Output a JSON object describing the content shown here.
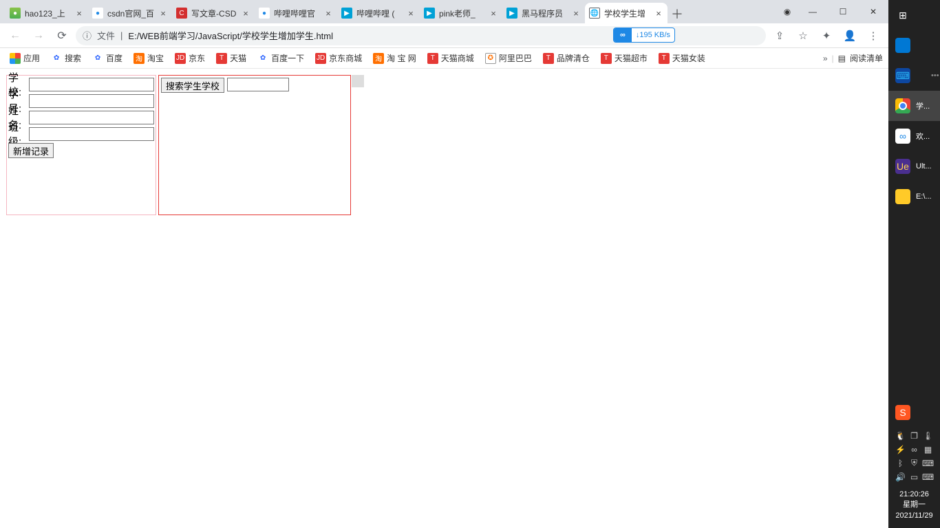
{
  "tabs": [
    {
      "title": "hao123_上",
      "favicon": "hao"
    },
    {
      "title": "csdn官网_百",
      "favicon": "csdn"
    },
    {
      "title": "写文章-CSD",
      "favicon": "c"
    },
    {
      "title": "哔哩哔哩官",
      "favicon": "csdn"
    },
    {
      "title": "哔哩哔哩 (",
      "favicon": "bili"
    },
    {
      "title": "pink老师_",
      "favicon": "bili"
    },
    {
      "title": "黑马程序员",
      "favicon": "bili"
    },
    {
      "title": "学校学生增",
      "favicon": "globe",
      "active": true
    }
  ],
  "address": {
    "prefix": "文件",
    "url": "E:/WEB前端学习/JavaScript/学校学生增加学生.html"
  },
  "netbadge": {
    "speed": "195 KB/s"
  },
  "bookmarks": [
    {
      "label": "应用",
      "ico": "apps"
    },
    {
      "label": "搜索",
      "ico": "baidu"
    },
    {
      "label": "百度",
      "ico": "baidu"
    },
    {
      "label": "淘宝",
      "ico": "tb"
    },
    {
      "label": "京东",
      "ico": "jd"
    },
    {
      "label": "天猫",
      "ico": "t"
    },
    {
      "label": "百度一下",
      "ico": "baidu"
    },
    {
      "label": "京东商城",
      "ico": "jd"
    },
    {
      "label": "淘 宝 网",
      "ico": "tb"
    },
    {
      "label": "天猫商城",
      "ico": "t"
    },
    {
      "label": "阿里巴巴",
      "ico": "ali"
    },
    {
      "label": "品牌清仓",
      "ico": "t"
    },
    {
      "label": "天猫超市",
      "ico": "t"
    },
    {
      "label": "天猫女装",
      "ico": "t"
    }
  ],
  "bookmarks_right": {
    "reading_list": "阅读清单"
  },
  "form": {
    "school_label": "学校:",
    "id_label": "学号:",
    "name_label": "姓名:",
    "class_label": "班级:",
    "add_btn": "新增记录",
    "search_btn": "搜索学生学校"
  },
  "taskbar_items": [
    {
      "label": "",
      "ico": "win"
    },
    {
      "label": "",
      "ico": "msg"
    },
    {
      "label": "",
      "ico": "vscode",
      "dot": true
    },
    {
      "label": "学...",
      "ico": "chrome",
      "active": true
    },
    {
      "label": "欢...",
      "ico": "bdisk"
    },
    {
      "label": "Ult...",
      "ico": "ue"
    },
    {
      "label": "E:\\...",
      "ico": "folder"
    }
  ],
  "tray_icons": [
    "sogou",
    "qq",
    "win",
    "temp",
    "flash",
    "bdisk",
    "doc",
    "bt",
    "shield",
    "kb",
    "vol",
    "notif"
  ],
  "clock": {
    "time": "21:20:26",
    "weekday": "星期一",
    "date": "2021/11/29"
  }
}
